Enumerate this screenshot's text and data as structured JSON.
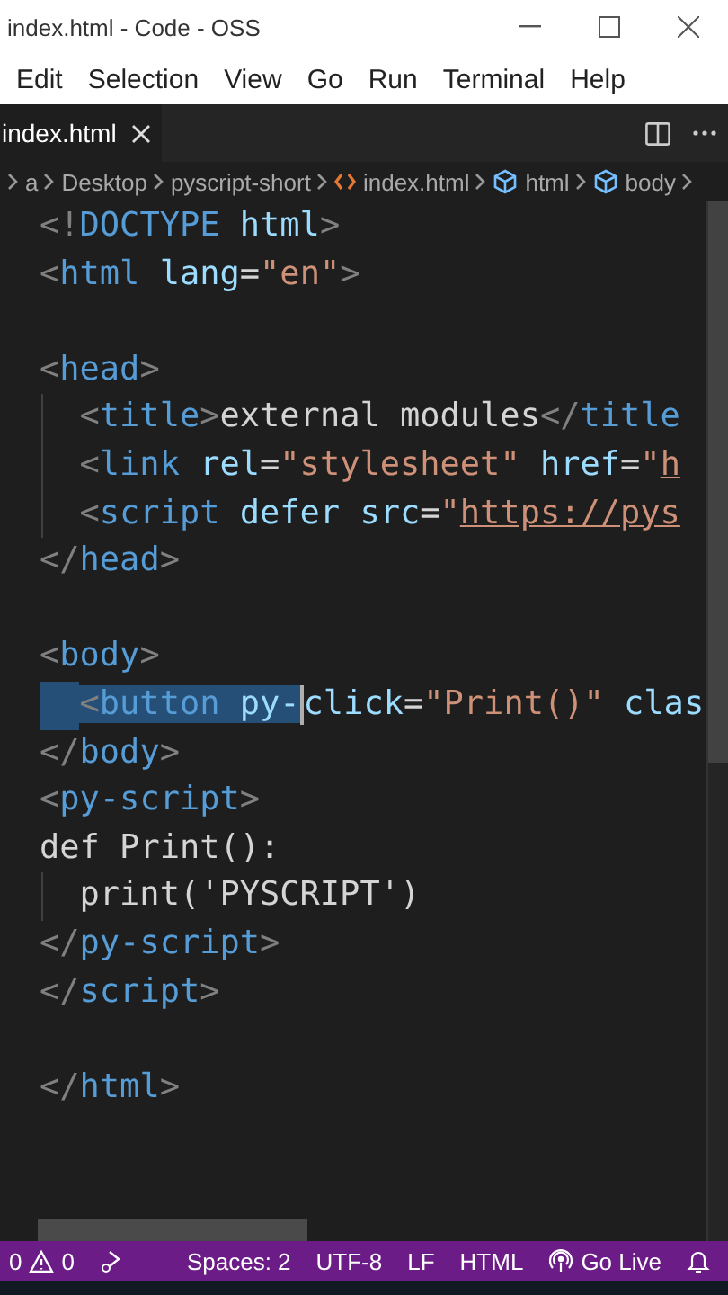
{
  "window": {
    "title": "index.html - Code - OSS"
  },
  "menu": [
    "Edit",
    "Selection",
    "View",
    "Go",
    "Run",
    "Terminal",
    "Help"
  ],
  "tabs": [
    {
      "label": "index.html",
      "selected": true
    }
  ],
  "breadcrumb": [
    {
      "label": "a",
      "kind": "folder"
    },
    {
      "label": "Desktop",
      "kind": "folder"
    },
    {
      "label": "pyscript-short",
      "kind": "folder"
    },
    {
      "label": "index.html",
      "kind": "file"
    },
    {
      "label": "html",
      "kind": "element"
    },
    {
      "label": "body",
      "kind": "element"
    }
  ],
  "code": [
    {
      "guide": false,
      "tokens": [
        {
          "kind": "punct",
          "text": "<!"
        },
        {
          "kind": "tag",
          "text": "DOCTYPE"
        },
        {
          "kind": "attr",
          "text": " html"
        },
        {
          "kind": "punct",
          "text": ">"
        }
      ]
    },
    {
      "guide": false,
      "tokens": [
        {
          "kind": "punct",
          "text": "<"
        },
        {
          "kind": "tag",
          "text": "html"
        },
        {
          "kind": "attr",
          "text": " lang"
        },
        {
          "kind": "text",
          "text": "="
        },
        {
          "kind": "string",
          "text": "\"en\""
        },
        {
          "kind": "punct",
          "text": ">"
        }
      ]
    },
    {
      "guide": false,
      "indented": false
    },
    {
      "guide": false,
      "tokens": [
        {
          "kind": "punct",
          "text": "<"
        },
        {
          "kind": "tag",
          "text": "head"
        },
        {
          "kind": "punct",
          "text": ">"
        }
      ]
    },
    {
      "guide": true,
      "indented": true,
      "tokens": [
        {
          "kind": "punct",
          "text": "<"
        },
        {
          "kind": "tag",
          "text": "title"
        },
        {
          "kind": "punct",
          "text": ">"
        },
        {
          "kind": "text",
          "text": "external modules"
        },
        {
          "kind": "punct",
          "text": "</"
        },
        {
          "kind": "tag",
          "text": "title"
        }
      ]
    },
    {
      "guide": true,
      "indented": true,
      "tokens": [
        {
          "kind": "punct",
          "text": "<"
        },
        {
          "kind": "tag",
          "text": "link"
        },
        {
          "kind": "attr",
          "text": " rel"
        },
        {
          "kind": "text",
          "text": "="
        },
        {
          "kind": "string",
          "text": "\"stylesheet\""
        },
        {
          "kind": "attr",
          "text": " href"
        },
        {
          "kind": "text",
          "text": "="
        },
        {
          "kind": "string",
          "text": "\""
        },
        {
          "kind": "link",
          "text": "h"
        }
      ]
    },
    {
      "guide": true,
      "indented": true,
      "tokens": [
        {
          "kind": "punct",
          "text": "<"
        },
        {
          "kind": "tag",
          "text": "script"
        },
        {
          "kind": "attr",
          "text": " defer src"
        },
        {
          "kind": "text",
          "text": "="
        },
        {
          "kind": "string",
          "text": "\""
        },
        {
          "kind": "link",
          "text": "https://pys"
        }
      ]
    },
    {
      "guide": false,
      "tokens": [
        {
          "kind": "punct",
          "text": "</"
        },
        {
          "kind": "tag",
          "text": "head"
        },
        {
          "kind": "punct",
          "text": ">"
        }
      ]
    },
    {
      "guide": false,
      "indented": false
    },
    {
      "guide": false,
      "tokens": [
        {
          "kind": "punct",
          "text": "<"
        },
        {
          "kind": "tag",
          "text": "body"
        },
        {
          "kind": "punct",
          "text": ">"
        }
      ]
    },
    {
      "guide": false,
      "indented": true,
      "tokens": [
        {
          "kind": "punct",
          "text": "<",
          "selected": true
        },
        {
          "kind": "tag",
          "text": "button",
          "selected": true
        },
        {
          "kind": "attr",
          "text": " py-",
          "selected": true
        },
        {
          "kind": "attr",
          "text": "click",
          "selected": false
        },
        {
          "kind": "text",
          "text": "=",
          "selected": false
        },
        {
          "kind": "string",
          "text": "\"Print()\"",
          "selected": false
        },
        {
          "kind": "attr",
          "text": " clas",
          "selected": false
        }
      ]
    },
    {
      "guide": false,
      "tokens": [
        {
          "kind": "punct",
          "text": "</"
        },
        {
          "kind": "tag",
          "text": "body"
        },
        {
          "kind": "punct",
          "text": ">"
        }
      ]
    },
    {
      "guide": false,
      "tokens": [
        {
          "kind": "punct",
          "text": "<"
        },
        {
          "kind": "tag",
          "text": "py-script"
        },
        {
          "kind": "punct",
          "text": ">"
        }
      ]
    },
    {
      "guide": false,
      "tokens": [
        {
          "kind": "text",
          "text": "def Print():"
        }
      ]
    },
    {
      "guide": true,
      "indented": true,
      "tokens": [
        {
          "kind": "text",
          "text": "print('PYSCRIPT')"
        }
      ]
    },
    {
      "guide": false,
      "tokens": [
        {
          "kind": "punct",
          "text": "</"
        },
        {
          "kind": "tag",
          "text": "py-script"
        },
        {
          "kind": "punct",
          "text": ">"
        }
      ]
    },
    {
      "guide": false,
      "tokens": [
        {
          "kind": "punct",
          "text": "</"
        },
        {
          "kind": "tag",
          "text": "script"
        },
        {
          "kind": "punct",
          "text": ">"
        }
      ]
    },
    {
      "guide": false,
      "indented": false
    },
    {
      "guide": false,
      "tokens": [
        {
          "kind": "punct",
          "text": "</"
        },
        {
          "kind": "tag",
          "text": "html"
        },
        {
          "kind": "punct",
          "text": ">"
        }
      ]
    }
  ],
  "status_bar": {
    "errors": "0",
    "warnings": "0",
    "items": [
      "Spaces: 2",
      "UTF-8",
      "LF",
      "HTML"
    ],
    "go_live": "Go Live"
  }
}
